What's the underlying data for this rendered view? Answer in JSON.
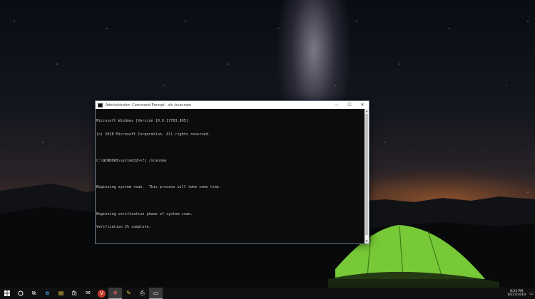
{
  "window": {
    "title": "Administrator: Command Prompt - sfc /scannow",
    "minimize_glyph": "—",
    "maximize_glyph": "☐",
    "close_glyph": "✕"
  },
  "console": {
    "lines": [
      "Microsoft Windows [Version 10.0.17763.805]",
      "(c) 2018 Microsoft Corporation. All rights reserved.",
      "",
      "C:\\WINDOWS\\system32>sfc /scannow",
      "",
      "Beginning system scan.  This process will take some time.",
      "",
      "Beginning verification phase of system scan.",
      "Verification 2% complete."
    ]
  },
  "taskbar": {
    "start_icon": "windows-logo-icon",
    "search_icon": "cortana-circle-icon",
    "items": [
      {
        "name": "task-view-icon",
        "glyph": "⧉"
      },
      {
        "name": "edge-icon",
        "glyph": "e"
      },
      {
        "name": "file-explorer-icon",
        "glyph": "▤"
      },
      {
        "name": "store-icon",
        "glyph": "🛍"
      },
      {
        "name": "mail-icon",
        "glyph": "✉"
      },
      {
        "name": "vivaldi-icon",
        "glyph": "V"
      },
      {
        "name": "photos-icon",
        "glyph": "❖"
      },
      {
        "name": "paint-icon",
        "glyph": "✎"
      },
      {
        "name": "printer-icon",
        "glyph": "⎙"
      },
      {
        "name": "command-prompt-icon",
        "glyph": "▭"
      }
    ],
    "clock": {
      "time": "8:23 PM",
      "date": "10/27/2019"
    }
  },
  "colors": {
    "console_bg": "#0c0c0c",
    "console_text": "#c8c8c8",
    "taskbar_bg": "#101010",
    "tent_green": "#7dd43a"
  }
}
